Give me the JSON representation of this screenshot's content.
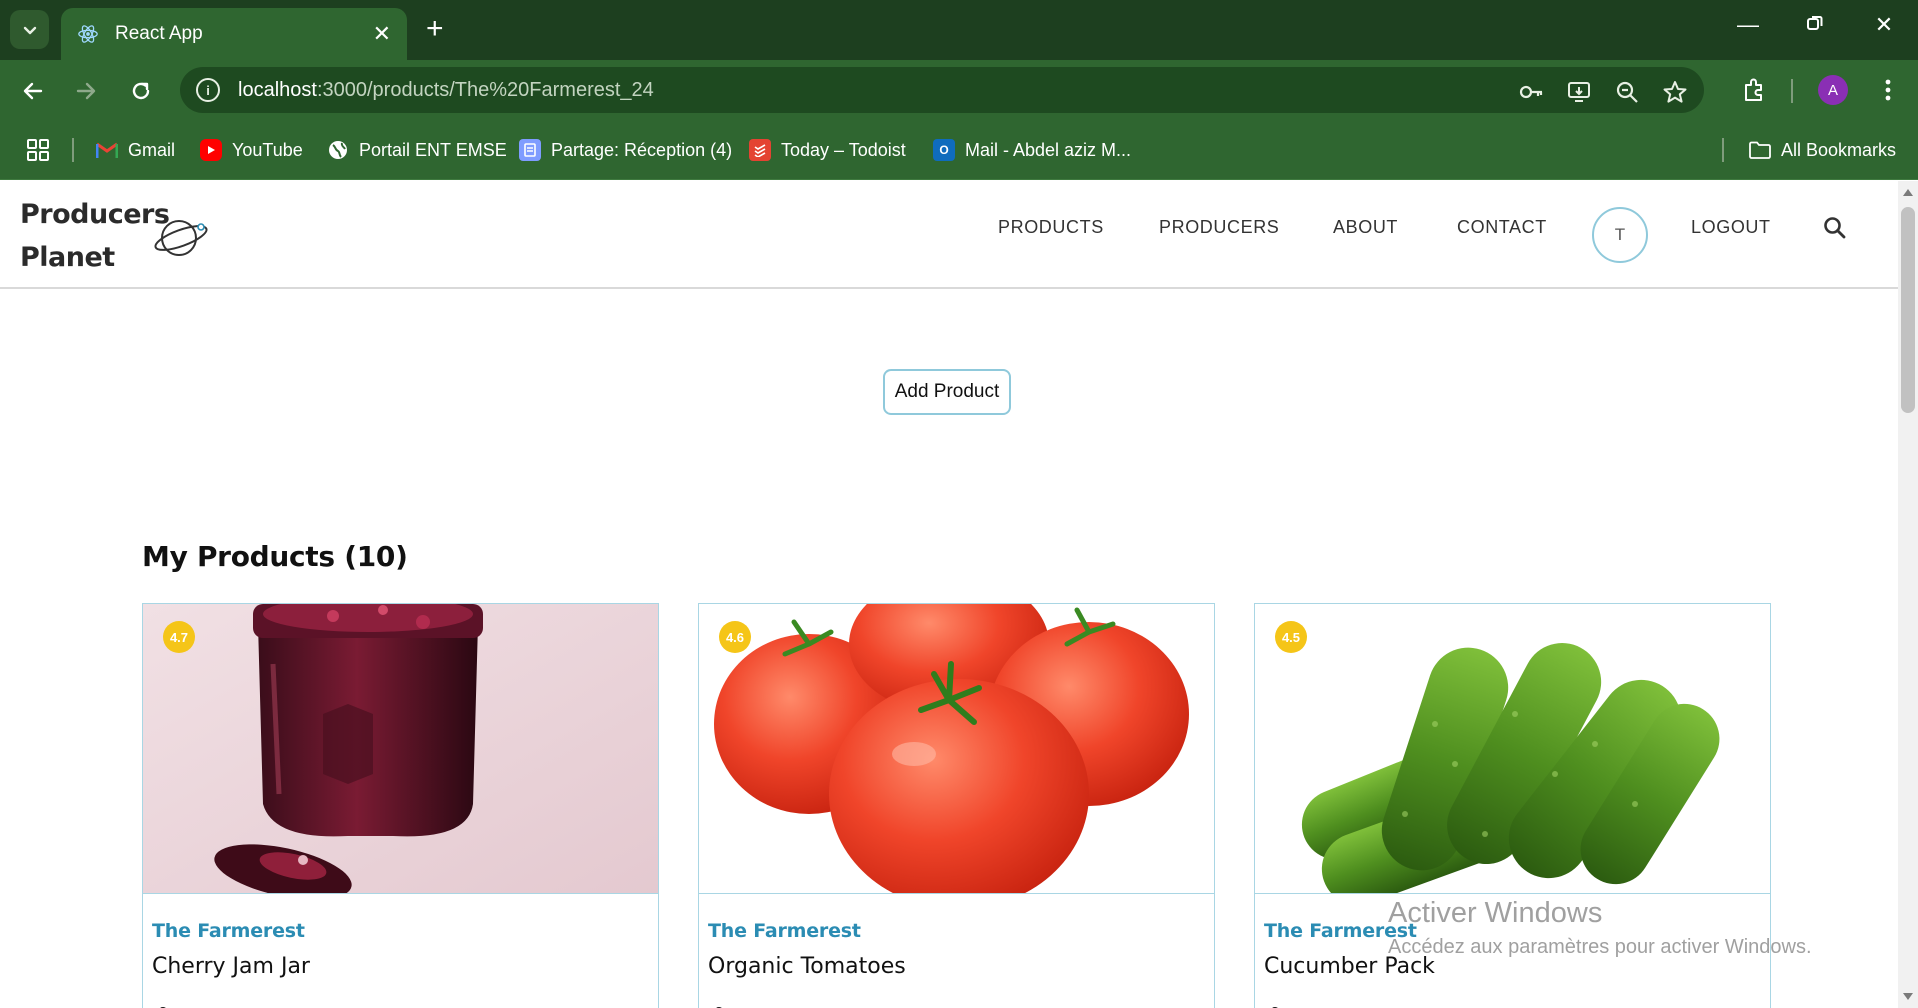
{
  "browser": {
    "tab_title": "React App",
    "url_host": "localhost",
    "url_path": ":3000/products/The%20Farmerest_24",
    "profile_initial": "A",
    "bookmarks": [
      {
        "label": "Gmail",
        "icon": "gmail-icon",
        "color": "#ea4335"
      },
      {
        "label": "YouTube",
        "icon": "youtube-icon",
        "color": "#ff0000"
      },
      {
        "label": "Portail ENT EMSE",
        "icon": "globe-icon",
        "color": "#ffffff"
      },
      {
        "label": "Partage: Réception (4)",
        "icon": "partage-icon",
        "color": "#6b8cff"
      },
      {
        "label": "Today – Todoist",
        "icon": "todoist-icon",
        "color": "#e44332"
      },
      {
        "label": "Mail - Abdel aziz M...",
        "icon": "outlook-icon",
        "color": "#0f6cbd"
      }
    ],
    "all_bookmarks_label": "All Bookmarks"
  },
  "site": {
    "logo_line1": "Producers",
    "logo_line2": "Planet",
    "nav": {
      "products": "PRODUCTS",
      "producers": "PRODUCERS",
      "about": "ABOUT",
      "contact": "CONTACT",
      "user_initial": "T",
      "logout": "LOGOUT"
    }
  },
  "main": {
    "add_product_label": "Add Product",
    "section_title": "My Products (10)",
    "products": [
      {
        "rating": "4.7",
        "producer": "The Farmerest",
        "name": "Cherry Jam Jar",
        "image": "cherry-jam-image"
      },
      {
        "rating": "4.6",
        "producer": "The Farmerest",
        "name": "Organic Tomatoes",
        "image": "tomatoes-image"
      },
      {
        "rating": "4.5",
        "producer": "The Farmerest",
        "name": "Cucumber Pack",
        "image": "cucumbers-image"
      }
    ]
  },
  "watermark": {
    "title": "Activer Windows",
    "subtitle": "Accédez aux paramètres pour activer Windows."
  }
}
